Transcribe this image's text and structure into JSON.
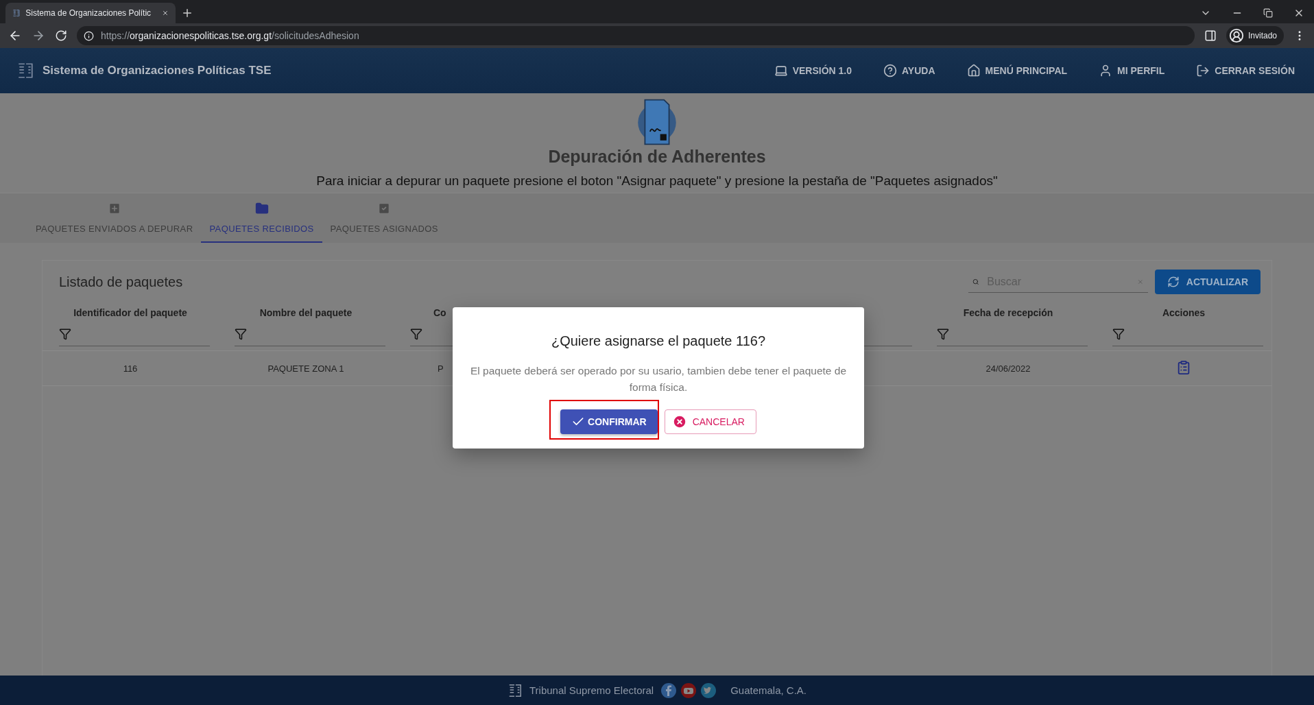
{
  "browser": {
    "tab_title": "Sistema de Organizaciones Polític",
    "url_scheme": "https://",
    "url_host": "organizacionespoliticas.tse.org.gt",
    "url_path": "/solicitudesAdhesion",
    "profile": "Invitado"
  },
  "header": {
    "title": "Sistema de Organizaciones Políticas TSE",
    "nav": [
      {
        "kind": "version",
        "label": "VERSIÓN 1.0"
      },
      {
        "kind": "help",
        "label": "AYUDA"
      },
      {
        "kind": "home",
        "label": "MENÚ PRINCIPAL"
      },
      {
        "kind": "profile",
        "label": "MI PERFIL"
      },
      {
        "kind": "logout",
        "label": "CERRAR SESIÓN"
      }
    ]
  },
  "page": {
    "title": "Depuración de Adherentes",
    "subtitle": "Para iniciar a depurar un paquete presione el boton \"Asignar paquete\" y presione la pestaña de \"Paquetes asignados\""
  },
  "tabs": [
    {
      "kind": "add",
      "label": "PAQUETES ENVIADOS A DEPURAR",
      "selected": false
    },
    {
      "kind": "folder",
      "label": "PAQUETES RECIBIDOS",
      "selected": true
    },
    {
      "kind": "check",
      "label": "PAQUETES ASIGNADOS",
      "selected": false
    }
  ],
  "list": {
    "title": "Listado de paquetes",
    "search": {
      "placeholder": "Buscar"
    },
    "refresh_button": "ACTUALIZAR",
    "columns": [
      "Identificador del paquete",
      "Nombre del paquete",
      "Co",
      "Fecha de recepción",
      "Acciones"
    ],
    "rows": [
      {
        "cells": [
          "116",
          "PAQUETE ZONA 1",
          "P",
          "24/06/2022"
        ]
      }
    ]
  },
  "dialog": {
    "title": "¿Quiere asignarse el paquete 116?",
    "message": "El paquete deberá ser operado por su usario, tambien debe tener el paquete de forma física.",
    "confirm": "CONFIRMAR",
    "cancel": "CANCELAR"
  },
  "footer": {
    "name": "Tribunal Supremo Electoral",
    "location": "Guatemala, C.A."
  }
}
